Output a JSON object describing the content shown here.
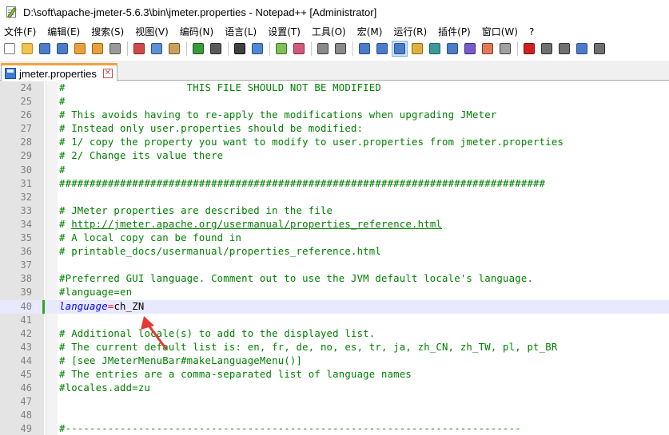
{
  "window": {
    "title": "D:\\soft\\apache-jmeter-5.6.3\\bin\\jmeter.properties - Notepad++ [Administrator]"
  },
  "menubar": {
    "items": [
      {
        "label": "文件(F)"
      },
      {
        "label": "编辑(E)"
      },
      {
        "label": "搜索(S)"
      },
      {
        "label": "视图(V)"
      },
      {
        "label": "编码(N)"
      },
      {
        "label": "语言(L)"
      },
      {
        "label": "设置(T)"
      },
      {
        "label": "工具(O)"
      },
      {
        "label": "宏(M)"
      },
      {
        "label": "运行(R)"
      },
      {
        "label": "插件(P)"
      },
      {
        "label": "窗口(W)"
      },
      {
        "label": "?"
      }
    ]
  },
  "toolbar": {
    "icons": [
      {
        "name": "new-file-icon",
        "color": "#ffffff",
        "border": "#7a7a7a"
      },
      {
        "name": "open-file-icon",
        "color": "#f2c44e",
        "border": "#b58a1b"
      },
      {
        "name": "save-icon",
        "color": "#4a7cc9",
        "border": "#2b4f8a"
      },
      {
        "name": "save-all-icon",
        "color": "#4a7cc9",
        "border": "#2b4f8a"
      },
      {
        "name": "close-icon",
        "color": "#e8a03c",
        "border": "#a35f10"
      },
      {
        "name": "close-all-icon",
        "color": "#e8a03c",
        "border": "#a35f10"
      },
      {
        "name": "print-icon",
        "color": "#9a9a9a",
        "border": "#555555"
      },
      {
        "name": "sep"
      },
      {
        "name": "cut-icon",
        "color": "#d04a4a",
        "border": "#8a2424"
      },
      {
        "name": "copy-icon",
        "color": "#5b8fd6",
        "border": "#2b4f8a"
      },
      {
        "name": "paste-icon",
        "color": "#c9a15a",
        "border": "#7a5a22"
      },
      {
        "name": "sep"
      },
      {
        "name": "undo-icon",
        "color": "#3a9a3a",
        "border": "#1e5e1e"
      },
      {
        "name": "redo-icon",
        "color": "#5a5a5a",
        "border": "#2a2a2a"
      },
      {
        "name": "sep"
      },
      {
        "name": "find-icon",
        "color": "#404040",
        "border": "#101010"
      },
      {
        "name": "replace-icon",
        "color": "#4a8ad6",
        "border": "#2b4f8a"
      },
      {
        "name": "sep"
      },
      {
        "name": "zoom-in-icon",
        "color": "#7fbf5a",
        "border": "#3a7a1e"
      },
      {
        "name": "zoom-out-icon",
        "color": "#d05a7a",
        "border": "#8a2440"
      },
      {
        "name": "sep"
      },
      {
        "name": "sync-vertical-icon",
        "color": "#8a8a8a",
        "border": "#404040"
      },
      {
        "name": "sync-horizontal-icon",
        "color": "#8a8a8a",
        "border": "#404040"
      },
      {
        "name": "sep"
      },
      {
        "name": "word-wrap-icon",
        "color": "#4a7cc9",
        "border": "#2b4f8a"
      },
      {
        "name": "show-all-chars-icon",
        "color": "#4a7cc9",
        "border": "#2b4f8a"
      },
      {
        "name": "indent-guide-icon",
        "color": "#4a7cc9",
        "border": "#2b4f8a",
        "active": true
      },
      {
        "name": "udl-icon",
        "color": "#e0b040",
        "border": "#8a6a10"
      },
      {
        "name": "doc-map-icon",
        "color": "#3a9a9a",
        "border": "#1e5e5e"
      },
      {
        "name": "doc-list-icon",
        "color": "#4a7cc9",
        "border": "#2b4f8a"
      },
      {
        "name": "function-list-icon",
        "color": "#7a5ac9",
        "border": "#3a2a8a"
      },
      {
        "name": "folder-workspace-icon",
        "color": "#e07a5a",
        "border": "#8a3a1e"
      },
      {
        "name": "monitoring-icon",
        "color": "#a0a0a0",
        "border": "#404040"
      },
      {
        "name": "sep"
      },
      {
        "name": "record-macro-icon",
        "color": "#d02020",
        "border": "#801010"
      },
      {
        "name": "stop-record-icon",
        "color": "#707070",
        "border": "#303030"
      },
      {
        "name": "play-macro-icon",
        "color": "#707070",
        "border": "#303030"
      },
      {
        "name": "run-macro-multiple-icon",
        "color": "#4a7cc9",
        "border": "#2b4f8a"
      },
      {
        "name": "save-macro-icon",
        "color": "#707070",
        "border": "#303030"
      }
    ]
  },
  "tab": {
    "label": "jmeter.properties",
    "close_glyph": "✕"
  },
  "editor": {
    "current_line": 40,
    "lines": [
      {
        "n": "24",
        "segs": [
          {
            "t": "#                    THIS FILE SHOULD NOT BE MODIFIED",
            "c": "comment"
          }
        ]
      },
      {
        "n": "25",
        "segs": [
          {
            "t": "#",
            "c": "comment"
          }
        ]
      },
      {
        "n": "26",
        "segs": [
          {
            "t": "# This avoids having to re-apply the modifications when upgrading JMeter",
            "c": "comment"
          }
        ]
      },
      {
        "n": "27",
        "segs": [
          {
            "t": "# Instead only user.properties should be modified:",
            "c": "comment"
          }
        ]
      },
      {
        "n": "28",
        "segs": [
          {
            "t": "# 1/ copy the property you want to modify to user.properties from jmeter.properties",
            "c": "comment"
          }
        ]
      },
      {
        "n": "29",
        "segs": [
          {
            "t": "# 2/ Change its value there",
            "c": "comment"
          }
        ]
      },
      {
        "n": "30",
        "segs": [
          {
            "t": "#",
            "c": "comment"
          }
        ]
      },
      {
        "n": "31",
        "segs": [
          {
            "t": "################################################################################",
            "c": "comment"
          }
        ]
      },
      {
        "n": "32",
        "segs": []
      },
      {
        "n": "33",
        "segs": [
          {
            "t": "# JMeter properties are described in the file",
            "c": "comment"
          }
        ]
      },
      {
        "n": "34",
        "segs": [
          {
            "t": "# ",
            "c": "comment"
          },
          {
            "t": "http://jmeter.apache.org/usermanual/properties_reference.html",
            "c": "url"
          }
        ]
      },
      {
        "n": "35",
        "segs": [
          {
            "t": "# A local copy can be found in",
            "c": "comment"
          }
        ]
      },
      {
        "n": "36",
        "segs": [
          {
            "t": "# printable_docs/usermanual/properties_reference.html",
            "c": "comment"
          }
        ]
      },
      {
        "n": "37",
        "segs": []
      },
      {
        "n": "38",
        "segs": [
          {
            "t": "#Preferred GUI language. Comment out to use the JVM default locale's language.",
            "c": "comment"
          }
        ]
      },
      {
        "n": "39",
        "segs": [
          {
            "t": "#language=en",
            "c": "comment"
          }
        ]
      },
      {
        "n": "40",
        "segs": [
          {
            "t": "language",
            "c": "key"
          },
          {
            "t": "=",
            "c": "eq"
          },
          {
            "t": "ch_ZN",
            "c": "val"
          }
        ],
        "changed": true
      },
      {
        "n": "41",
        "segs": []
      },
      {
        "n": "42",
        "segs": [
          {
            "t": "# Additional locale(s) to add to the displayed list.",
            "c": "comment"
          }
        ]
      },
      {
        "n": "43",
        "segs": [
          {
            "t": "# The current default list is: en, fr, de, no, es, tr, ja, zh_CN, zh_TW, pl, pt_BR",
            "c": "comment"
          }
        ]
      },
      {
        "n": "44",
        "segs": [
          {
            "t": "# [see JMeterMenuBar#makeLanguageMenu()]",
            "c": "comment"
          }
        ]
      },
      {
        "n": "45",
        "segs": [
          {
            "t": "# The entries are a comma-separated list of language names",
            "c": "comment"
          }
        ]
      },
      {
        "n": "46",
        "segs": [
          {
            "t": "#locales.add=zu",
            "c": "comment"
          }
        ]
      },
      {
        "n": "47",
        "segs": []
      },
      {
        "n": "48",
        "segs": []
      },
      {
        "n": "49",
        "segs": [
          {
            "t": "#---------------------------------------------------------------------------",
            "c": "comment"
          }
        ]
      }
    ]
  },
  "annotation": {
    "arrow_color": "#e53935"
  }
}
